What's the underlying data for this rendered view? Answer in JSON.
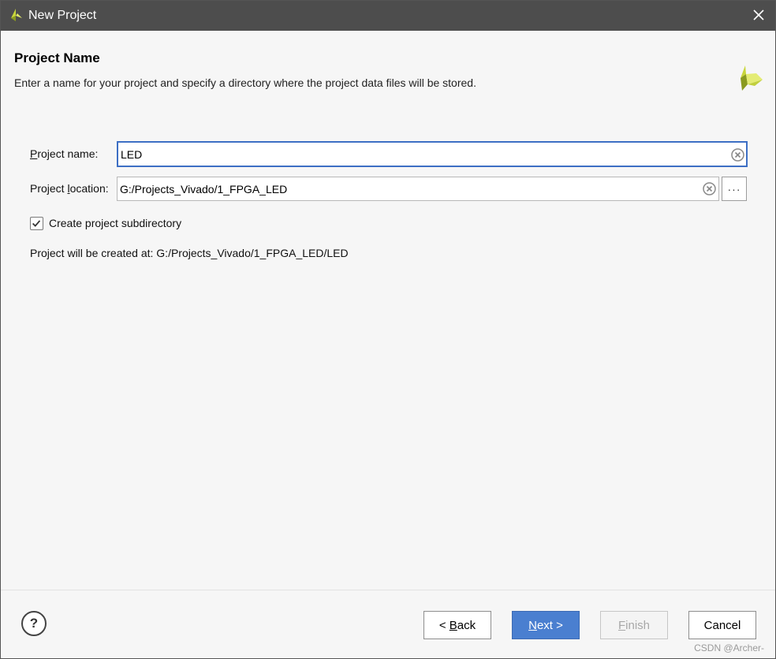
{
  "window": {
    "title": "New Project",
    "logo_icon": "vivado-logo-icon",
    "close_icon": "close-icon"
  },
  "header": {
    "heading": "Project Name",
    "description": "Enter a name for your project and specify a directory where the project data files will be stored."
  },
  "form": {
    "project_name": {
      "label_first": "P",
      "label_rest": "roject name:",
      "value": "LED"
    },
    "project_location": {
      "label_first": "Project ",
      "label_underlined": "l",
      "label_rest": "ocation:",
      "value": "G:/Projects_Vivado/1_FPGA_LED",
      "browse_label": "···"
    },
    "subdirectory": {
      "label": "Create project subdirectory",
      "checked": true
    },
    "created_at": "Project will be created at: G:/Projects_Vivado/1_FPGA_LED/LED"
  },
  "footer": {
    "help_label": "?",
    "back_prefix": "< ",
    "back_underlined": "B",
    "back_rest": "ack",
    "next_underlined": "N",
    "next_rest": "ext >",
    "finish_underlined": "F",
    "finish_rest": "inish",
    "cancel_label": "Cancel"
  },
  "watermark": "CSDN @Archer-",
  "colors": {
    "titlebar": "#4d4d4d",
    "accent": "#4a7fd0",
    "focus_border": "#3d6fc4",
    "background": "#f6f6f6"
  }
}
